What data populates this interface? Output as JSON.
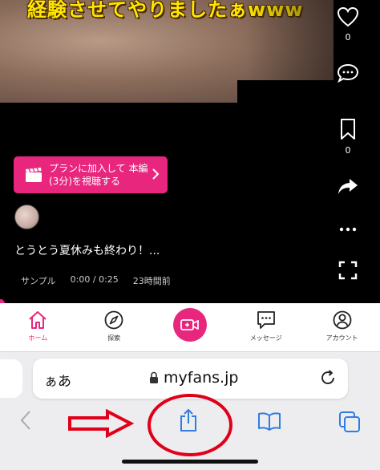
{
  "video": {
    "caption": "経験させてやりましたぁwww"
  },
  "side_actions": {
    "like_count": "0",
    "bookmark_count": "0"
  },
  "post": {
    "plan_button_label": "プランに加入して 本編(3分)を視聴する",
    "text": "とうとう夏休みも終わり！...",
    "sample_label": "サンプル",
    "time": "0:00 / 0:25",
    "posted_ago": "23時間前"
  },
  "tabbar": {
    "home": "ホーム",
    "explore": "探索",
    "messages": "メッセージ",
    "account": "アカウント"
  },
  "browser": {
    "aa": "ぁあ",
    "url": "myfans.jp"
  },
  "colors": {
    "brand_pink": "#e8267e",
    "annotation_red": "#e0001a",
    "safari_blue": "#2f7de1"
  }
}
